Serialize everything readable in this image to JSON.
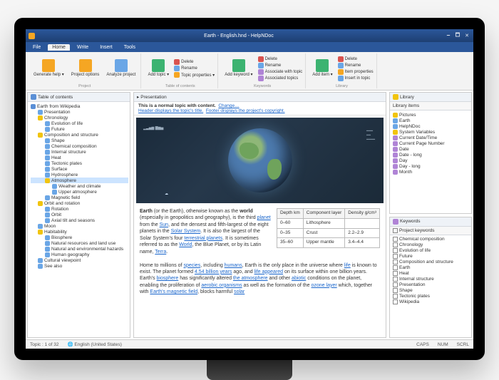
{
  "window": {
    "title": "Earth - English.hnd - HelpNDoc",
    "controls": [
      "🗕",
      "🗖",
      "✕"
    ]
  },
  "menubar": {
    "file": "File",
    "tabs": [
      "Home",
      "Write",
      "Insert",
      "Tools"
    ],
    "active": 0
  },
  "ribbon": {
    "groups": [
      {
        "label": "Project",
        "big": [
          {
            "name": "generate-help",
            "icon": "i-gear",
            "label": "Generate help ▾"
          },
          {
            "name": "project-options",
            "icon": "i-gear",
            "label": "Project options"
          },
          {
            "name": "analyze-project",
            "icon": "i-doc",
            "label": "Analyze project"
          }
        ],
        "small": []
      },
      {
        "label": "Table of contents",
        "big": [
          {
            "name": "add-topic",
            "icon": "i-plus",
            "label": "Add topic ▾"
          }
        ],
        "small": [
          {
            "name": "delete-topic",
            "icon": "i-del",
            "label": "Delete"
          },
          {
            "name": "rename-topic",
            "icon": "i-doc",
            "label": "Rename"
          },
          {
            "name": "topic-properties",
            "icon": "i-gear",
            "label": "Topic properties ▾"
          }
        ]
      },
      {
        "label": "Keywords",
        "big": [
          {
            "name": "add-keyword",
            "icon": "i-plus",
            "label": "Add keyword ▾"
          }
        ],
        "small": [
          {
            "name": "delete-keyword",
            "icon": "i-del",
            "label": "Delete"
          },
          {
            "name": "rename-keyword",
            "icon": "i-doc",
            "label": "Rename"
          },
          {
            "name": "associate-with-topic",
            "icon": "i-tag",
            "label": "Associate with topic"
          },
          {
            "name": "associated-topics",
            "icon": "i-tag",
            "label": "Associated topics"
          }
        ]
      },
      {
        "label": "Library",
        "big": [
          {
            "name": "add-item",
            "icon": "i-plus",
            "label": "Add item ▾"
          }
        ],
        "small": [
          {
            "name": "delete-item",
            "icon": "i-del",
            "label": "Delete"
          },
          {
            "name": "rename-item",
            "icon": "i-doc",
            "label": "Rename"
          },
          {
            "name": "item-properties",
            "icon": "i-gear",
            "label": "Item properties"
          },
          {
            "name": "insert-in-topic",
            "icon": "i-doc",
            "label": "Insert in topic"
          }
        ]
      }
    ]
  },
  "toc": {
    "title": "Table of contents",
    "items": [
      {
        "d": 0,
        "icon": "i-book",
        "label": "Earth from Wikipedia"
      },
      {
        "d": 1,
        "icon": "i-doc",
        "label": "Presentation"
      },
      {
        "d": 1,
        "icon": "i-folder",
        "label": "Chronology"
      },
      {
        "d": 2,
        "icon": "i-doc",
        "label": "Evolution of life"
      },
      {
        "d": 2,
        "icon": "i-doc",
        "label": "Future"
      },
      {
        "d": 1,
        "icon": "i-folder",
        "label": "Composition and structure"
      },
      {
        "d": 2,
        "icon": "i-doc",
        "label": "Shape"
      },
      {
        "d": 2,
        "icon": "i-doc",
        "label": "Chemical composition"
      },
      {
        "d": 2,
        "icon": "i-doc",
        "label": "Internal structure"
      },
      {
        "d": 2,
        "icon": "i-doc",
        "label": "Heat"
      },
      {
        "d": 2,
        "icon": "i-doc",
        "label": "Tectonic plates"
      },
      {
        "d": 2,
        "icon": "i-doc",
        "label": "Surface"
      },
      {
        "d": 2,
        "icon": "i-doc",
        "label": "Hydrosphere"
      },
      {
        "d": 2,
        "icon": "i-folder",
        "label": "Atmosphere",
        "sel": true
      },
      {
        "d": 3,
        "icon": "i-doc",
        "label": "Weather and climate"
      },
      {
        "d": 3,
        "icon": "i-doc",
        "label": "Upper atmosphere"
      },
      {
        "d": 2,
        "icon": "i-doc",
        "label": "Magnetic field"
      },
      {
        "d": 1,
        "icon": "i-folder",
        "label": "Orbit and rotation"
      },
      {
        "d": 2,
        "icon": "i-doc",
        "label": "Rotation"
      },
      {
        "d": 2,
        "icon": "i-doc",
        "label": "Orbit"
      },
      {
        "d": 2,
        "icon": "i-doc",
        "label": "Axial tilt and seasons"
      },
      {
        "d": 1,
        "icon": "i-doc",
        "label": "Moon"
      },
      {
        "d": 1,
        "icon": "i-folder",
        "label": "Habitability"
      },
      {
        "d": 2,
        "icon": "i-doc",
        "label": "Biosphere"
      },
      {
        "d": 2,
        "icon": "i-doc",
        "label": "Natural resources and land use"
      },
      {
        "d": 2,
        "icon": "i-doc",
        "label": "Natural and environmental hazards"
      },
      {
        "d": 2,
        "icon": "i-doc",
        "label": "Human geography"
      },
      {
        "d": 1,
        "icon": "i-doc",
        "label": "Cultural viewpoint"
      },
      {
        "d": 1,
        "icon": "i-doc",
        "label": "See also"
      }
    ]
  },
  "editor": {
    "crumb": "Presentation",
    "info_line1_pre": "This is a normal topic with content.",
    "info_line1_link": "Change…",
    "info_line2_a": "Header displays the topic's title.",
    "info_line2_b": "Footer displays the project's copyright.",
    "para1_a": "Earth",
    "para1_b": " (or the Earth), otherwise known as the ",
    "para1_c": "world",
    "para1_d": " (especially in geopolitics and geography), is the third ",
    "para1_link1": "planet",
    "para1_e": " from the ",
    "para1_link2": "Sun",
    "para1_f": ", and the densest and fifth-largest of the eight planets in the ",
    "para1_link3": "Solar System",
    "para1_g": ". It is also the largest of the Solar System's four ",
    "para1_link4": "terrestrial planets",
    "para1_h": ". It is sometimes referred to as the ",
    "para1_link5": "World",
    "para1_i": ", the Blue Planet, or by its Latin name, ",
    "para1_link6": "Terra",
    "para1_j": ".",
    "para2_a": "Home to millions of ",
    "para2_link1": "species",
    "para2_b": ", including ",
    "para2_link2": "humans",
    "para2_c": ", Earth is the only place in the universe where ",
    "para2_link3": "life",
    "para2_d": " is known to exist. The planet formed ",
    "para2_link4": "4.54 billion years",
    "para2_e": " ago, and ",
    "para2_link5": "life appeared",
    "para2_f": " on its surface within one billion years. Earth's ",
    "para2_link6": "biosphere",
    "para2_g": " has significantly altered ",
    "para2_link7": "the atmosphere",
    "para2_h": " and other ",
    "para2_link8": "abiotic",
    "para2_i": " conditions on the planet, enabling the proliferation of ",
    "para2_link9": "aerobic organisms",
    "para2_j": " as well as the formation of the ",
    "para2_link10": "ozone layer",
    "para2_k": " which, together with ",
    "para2_link11": "Earth's magnetic field",
    "para2_l": ", blocks harmful ",
    "para2_link12": "solar",
    "table": {
      "h1": "Depth km",
      "h2": "Component layer",
      "h3": "Density g/cm³",
      "rows": [
        {
          "c1": "0–60",
          "c2": "Lithosphere",
          "c3": ""
        },
        {
          "c1": "0–35",
          "c2": "Crust",
          "c3": "2.2–2.9"
        },
        {
          "c1": "35–60",
          "c2": "Upper mantle",
          "c3": "3.4–4.4"
        }
      ]
    }
  },
  "library": {
    "title": "Library",
    "sub": "Library items",
    "items": [
      {
        "d": 0,
        "icon": "i-folder",
        "label": "Pictures"
      },
      {
        "d": 1,
        "icon": "i-doc",
        "label": "Earth"
      },
      {
        "d": 1,
        "icon": "i-doc",
        "label": "HelpNDoc"
      },
      {
        "d": 0,
        "icon": "i-folder",
        "label": "System Variables"
      },
      {
        "d": 1,
        "icon": "i-tag",
        "label": "Current Date/Time"
      },
      {
        "d": 1,
        "icon": "i-tag",
        "label": "Current Page Number"
      },
      {
        "d": 1,
        "icon": "i-tag",
        "label": "Date"
      },
      {
        "d": 1,
        "icon": "i-tag",
        "label": "Date - long"
      },
      {
        "d": 1,
        "icon": "i-tag",
        "label": "Day"
      },
      {
        "d": 1,
        "icon": "i-tag",
        "label": "Day - long"
      },
      {
        "d": 1,
        "icon": "i-tag",
        "label": "Month"
      }
    ]
  },
  "keywords": {
    "title": "Keywords",
    "sub": "Project keywords",
    "items": [
      {
        "label": "Chemical composition"
      },
      {
        "label": "Chronology"
      },
      {
        "label": "Evolution of life",
        "d": 1
      },
      {
        "label": "Future",
        "d": 1
      },
      {
        "label": "Composition and structure"
      },
      {
        "label": "Earth"
      },
      {
        "label": "Heat"
      },
      {
        "label": "Internal structure"
      },
      {
        "label": "Presentation"
      },
      {
        "label": "Shape"
      },
      {
        "label": "Tectonic plates"
      },
      {
        "label": "Wikipedia"
      }
    ]
  },
  "statusbar": {
    "topic": "Topic : 1 of 32",
    "lang": "English (United States)",
    "caps": "CAPS",
    "num": "NUM",
    "scrl": "SCRL"
  }
}
